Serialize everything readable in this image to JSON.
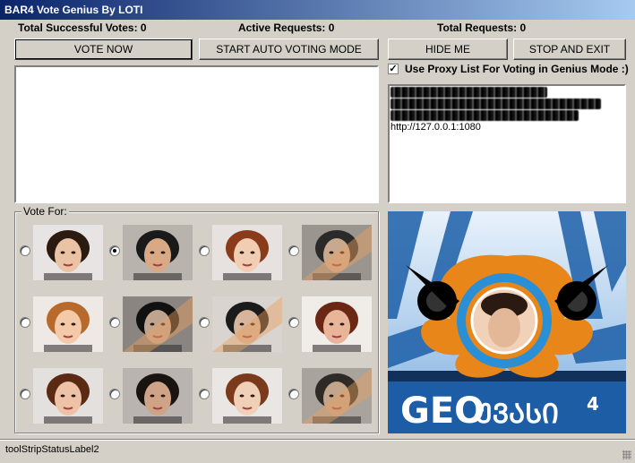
{
  "window": {
    "title": "BAR4 Vote Genius By LOTI"
  },
  "stats": {
    "successful": "Total Successful Votes: 0",
    "active": "Active Requests: 0",
    "total": "Total Requests: 0"
  },
  "buttons": {
    "vote_now": "VOTE NOW",
    "auto_mode": "START AUTO VOTING MODE",
    "hide": "HIDE ME",
    "stop_exit": "STOP AND EXIT"
  },
  "proxy": {
    "checked": true,
    "label": "Use Proxy List For Voting in Genius Mode :)",
    "visible_line": "http://127.0.0.1:1080"
  },
  "vote": {
    "label": "Vote For:",
    "selected_index": 1,
    "count": 12
  },
  "banner": {
    "brand": "GEO",
    "brand_suffix": "ᲣᲕᲐᲡᲘ",
    "edition": "4"
  },
  "statusbar": {
    "label": "toolStripStatusLabel2"
  },
  "colors": {
    "titlebar_start": "#0a246a",
    "titlebar_end": "#a6caf0",
    "window_bg": "#d4d0c8",
    "banner_orange": "#e8861a",
    "banner_blue": "#1c5fa8"
  }
}
